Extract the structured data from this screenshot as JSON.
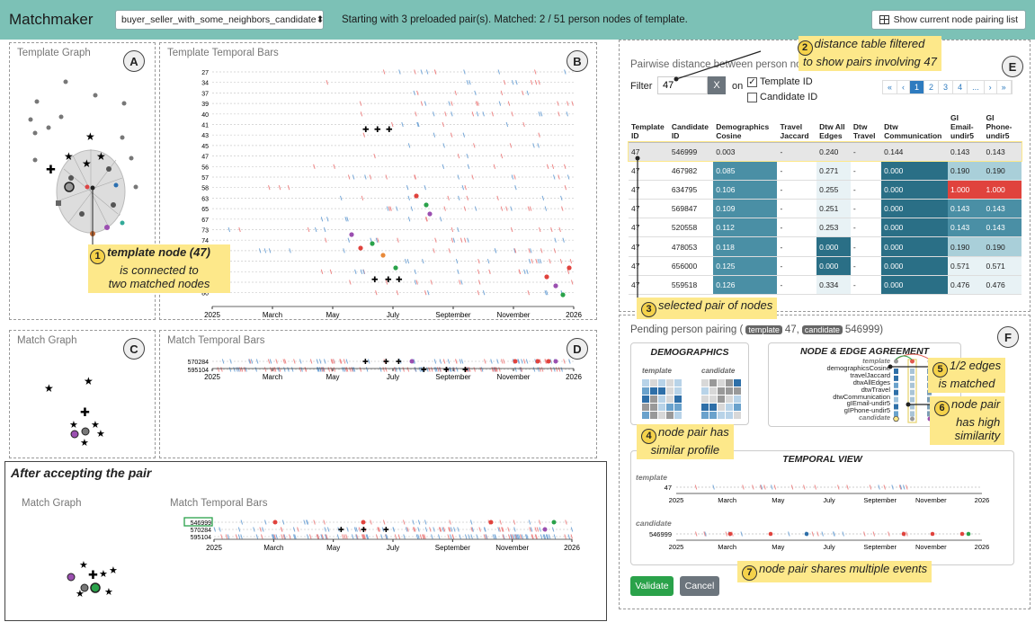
{
  "header": {
    "title": "Matchmaker",
    "template_select": "buyer_seller_with_some_neighbors_candidate",
    "status": "Starting with 3 preloaded pair(s). Matched: 2 / 51 person nodes of template.",
    "pairing_button": "Show current node pairing list"
  },
  "panels": {
    "template_graph": {
      "title": "Template Graph",
      "letter": "A"
    },
    "template_bars": {
      "title": "Template Temporal Bars",
      "letter": "B"
    },
    "match_graph": {
      "title": "Match Graph",
      "letter": "C"
    },
    "match_bars": {
      "title": "Match Temporal Bars",
      "letter": "D"
    },
    "distance": {
      "letter": "E"
    },
    "pending": {
      "letter": "F"
    }
  },
  "template_rows": [
    "27",
    "34",
    "37",
    "39",
    "40",
    "41",
    "43",
    "45",
    "47",
    "56",
    "57",
    "58",
    "63",
    "65",
    "67",
    "73",
    "74",
    "75",
    "77",
    "78",
    "79",
    "80"
  ],
  "timeline_ticks": [
    "2025",
    "March",
    "May",
    "July",
    "September",
    "November",
    "2026"
  ],
  "match_rows": [
    "570284",
    "595104"
  ],
  "after": {
    "title": "After accepting the pair",
    "graph_title": "Match Graph",
    "bars_title": "Match Temporal Bars",
    "rows": [
      "546999",
      "570284",
      "595104"
    ]
  },
  "distance": {
    "title": "Pairwise distance between person nodes",
    "filter_label": "Filter",
    "filter_value": "47",
    "clear": "X",
    "on_label": "on",
    "template_id_option": "Template ID",
    "candidate_id_option": "Candidate ID",
    "pages": [
      "«",
      "‹",
      "1",
      "2",
      "3",
      "4",
      "...",
      "›",
      "»"
    ],
    "columns": [
      "Template ID",
      "Candidate ID",
      "Demographics Cosine",
      "Travel Jaccard",
      "Dtw All Edges",
      "Dtw Travel",
      "Dtw Communication",
      "GI Email-undir5",
      "GI Phone-undir5"
    ],
    "rows": [
      [
        "47",
        "546999",
        "0.003",
        "-",
        "0.240",
        "-",
        "0.144",
        "0.143",
        "0.143"
      ],
      [
        "47",
        "467982",
        "0.085",
        "-",
        "0.271",
        "-",
        "0.000",
        "0.190",
        "0.190"
      ],
      [
        "47",
        "634795",
        "0.106",
        "-",
        "0.255",
        "-",
        "0.000",
        "1.000",
        "1.000"
      ],
      [
        "47",
        "569847",
        "0.109",
        "-",
        "0.251",
        "-",
        "0.000",
        "0.143",
        "0.143"
      ],
      [
        "47",
        "520558",
        "0.112",
        "-",
        "0.253",
        "-",
        "0.000",
        "0.143",
        "0.143"
      ],
      [
        "47",
        "478053",
        "0.118",
        "-",
        "0.000",
        "-",
        "0.000",
        "0.190",
        "0.190"
      ],
      [
        "47",
        "656000",
        "0.125",
        "-",
        "0.000",
        "-",
        "0.000",
        "0.571",
        "0.571"
      ],
      [
        "47",
        "559518",
        "0.126",
        "-",
        "0.334",
        "-",
        "0.000",
        "0.476",
        "0.476"
      ]
    ]
  },
  "pending": {
    "prefix": "Pending person pairing (",
    "template_badge": "template",
    "template_id": "47,",
    "candidate_badge": "candidate",
    "candidate_id": "546999)",
    "demographics": "DEMOGRAPHICS",
    "template_label": "template",
    "candidate_label": "candidate",
    "agreement": "NODE & EDGE AGREEMENT",
    "agreement_rows": [
      "template",
      "demographicsCosine",
      "travelJaccard",
      "dtwAllEdges",
      "dtwTravel",
      "dtwCommunication",
      "gIEmail-undir5",
      "gIPhone-undir5",
      "candidate"
    ],
    "temporal": "TEMPORAL VIEW",
    "t_label": "template",
    "t_id": "47",
    "c_label": "candidate",
    "c_id": "546999",
    "validate": "Validate",
    "cancel": "Cancel"
  },
  "annotations": {
    "a1_num": "1",
    "a1_bold": "template node (47)",
    "a1_rest1": "is connected to",
    "a1_rest2": "two matched nodes",
    "a2_num": "2",
    "a2_l1": "distance table filtered",
    "a2_l2": "to show pairs involving 47",
    "a3_num": "3",
    "a3": "selected pair of nodes",
    "a4_num": "4",
    "a4_l1": "node pair has",
    "a4_l2": "similar profile",
    "a5_num": "5",
    "a5_l1": "1/2 edges",
    "a5_l2": "is matched",
    "a6_num": "6",
    "a6_l1": "node pair",
    "a6_l2": "has high",
    "a6_l3": "similarity",
    "a7_num": "7",
    "a7": "node pair shares multiple events"
  },
  "colors": {
    "header": "#7cc1b6",
    "accent": "#2e7bbf",
    "dark_teal": "#2a6f86",
    "mid_teal": "#4a8fa5",
    "light_teal": "#a9cfd9",
    "red": "#e0433d",
    "green": "#2aa24a",
    "highlight": "#fde88a"
  }
}
